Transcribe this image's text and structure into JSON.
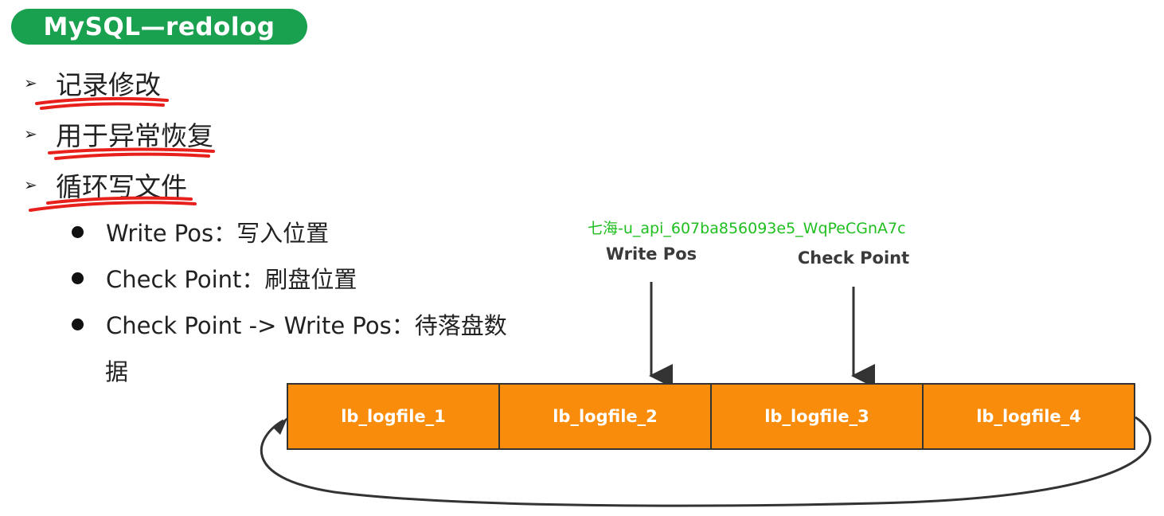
{
  "title": "MySQL—redolog",
  "bullets": [
    {
      "label": "记录修改"
    },
    {
      "label": "用于异常恢复"
    },
    {
      "label": "循环写文件"
    }
  ],
  "sub_bullets": [
    {
      "label": "Write Pos：写入位置"
    },
    {
      "label": "Check Point：刷盘位置"
    },
    {
      "label": "Check Point -> Write Pos：待落盘数",
      "continuation": "据"
    }
  ],
  "watermark": "七海-u_api_607ba856093e5_WqPeCGnA7c",
  "pointers": {
    "write_pos": "Write Pos",
    "check_point": "Check Point"
  },
  "logfiles": [
    "lb_logfile_1",
    "lb_logfile_2",
    "lb_logfile_3",
    "lb_logfile_4"
  ],
  "colors": {
    "title_bg": "#1aa150",
    "logfile_fill": "#f98c0a",
    "annotation_underline": "#e8201c",
    "watermark": "#1fbf1f"
  }
}
